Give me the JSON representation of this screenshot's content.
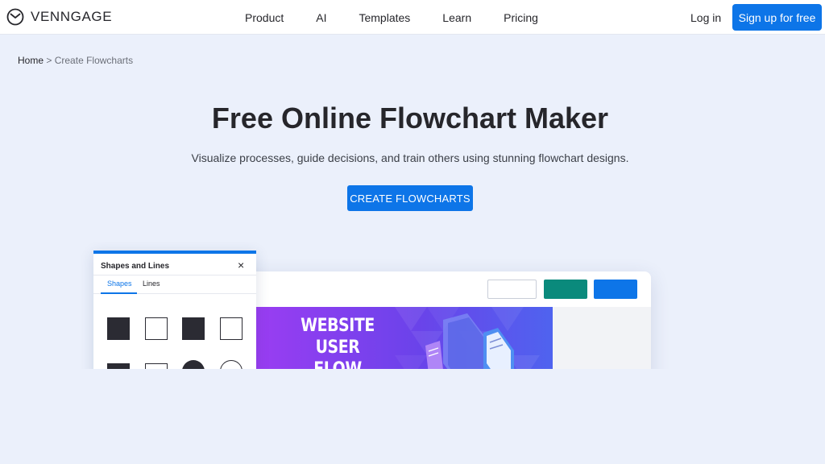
{
  "nav": {
    "logo_text": "VENNGAGE",
    "links": [
      "Product",
      "AI",
      "Templates",
      "Learn",
      "Pricing"
    ],
    "login": "Log in",
    "signup": "Sign up for free"
  },
  "breadcrumb": {
    "home": "Home",
    "separator": ">",
    "current": "Create Flowcharts"
  },
  "hero": {
    "title": "Free Online Flowchart Maker",
    "subtitle": "Visualize processes, guide decisions, and train others using stunning flowchart designs.",
    "cta": "CREATE FLOWCHARTS"
  },
  "preview": {
    "panel_title": "Shapes and Lines",
    "close_icon": "×",
    "tabs": [
      "Shapes",
      "Lines"
    ],
    "active_tab": "Shapes",
    "banner_title_line1": "WEBSITE USER",
    "banner_title_line2": "FLOW DIAGRAM"
  },
  "colors": {
    "brand_blue": "#0d75e8",
    "teal": "#0a8a7c",
    "page_bg": "#ebf0fb",
    "banner_purple": "#7f3df0"
  }
}
